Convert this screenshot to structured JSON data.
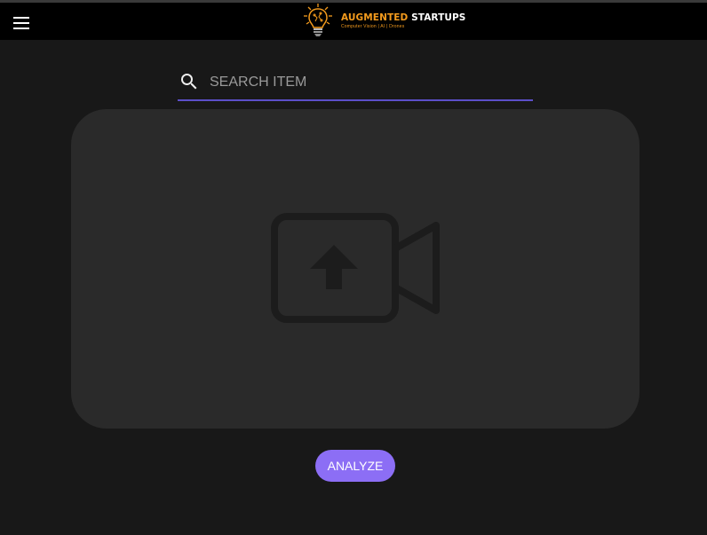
{
  "appbar": {
    "menu_icon": "hamburger-menu-icon",
    "logo": {
      "title_part1": "AUGMENTED",
      "title_part2": "STARTUPS",
      "tagline": "Computer Vision | AI | Drones",
      "icon": "lightbulb-brain-icon"
    }
  },
  "search": {
    "icon": "search-icon",
    "placeholder": "SEARCH ITEM",
    "value": ""
  },
  "dropzone": {
    "icon": "video-upload-icon"
  },
  "actions": {
    "analyze_label": "ANALYZE"
  },
  "colors": {
    "background": "#181818",
    "appbar": "#000000",
    "dropzone": "#2a2a2a",
    "accent": "#8c6ef5",
    "search_underline": "#5c4fc9",
    "brand_orange": "#f29a1d"
  }
}
